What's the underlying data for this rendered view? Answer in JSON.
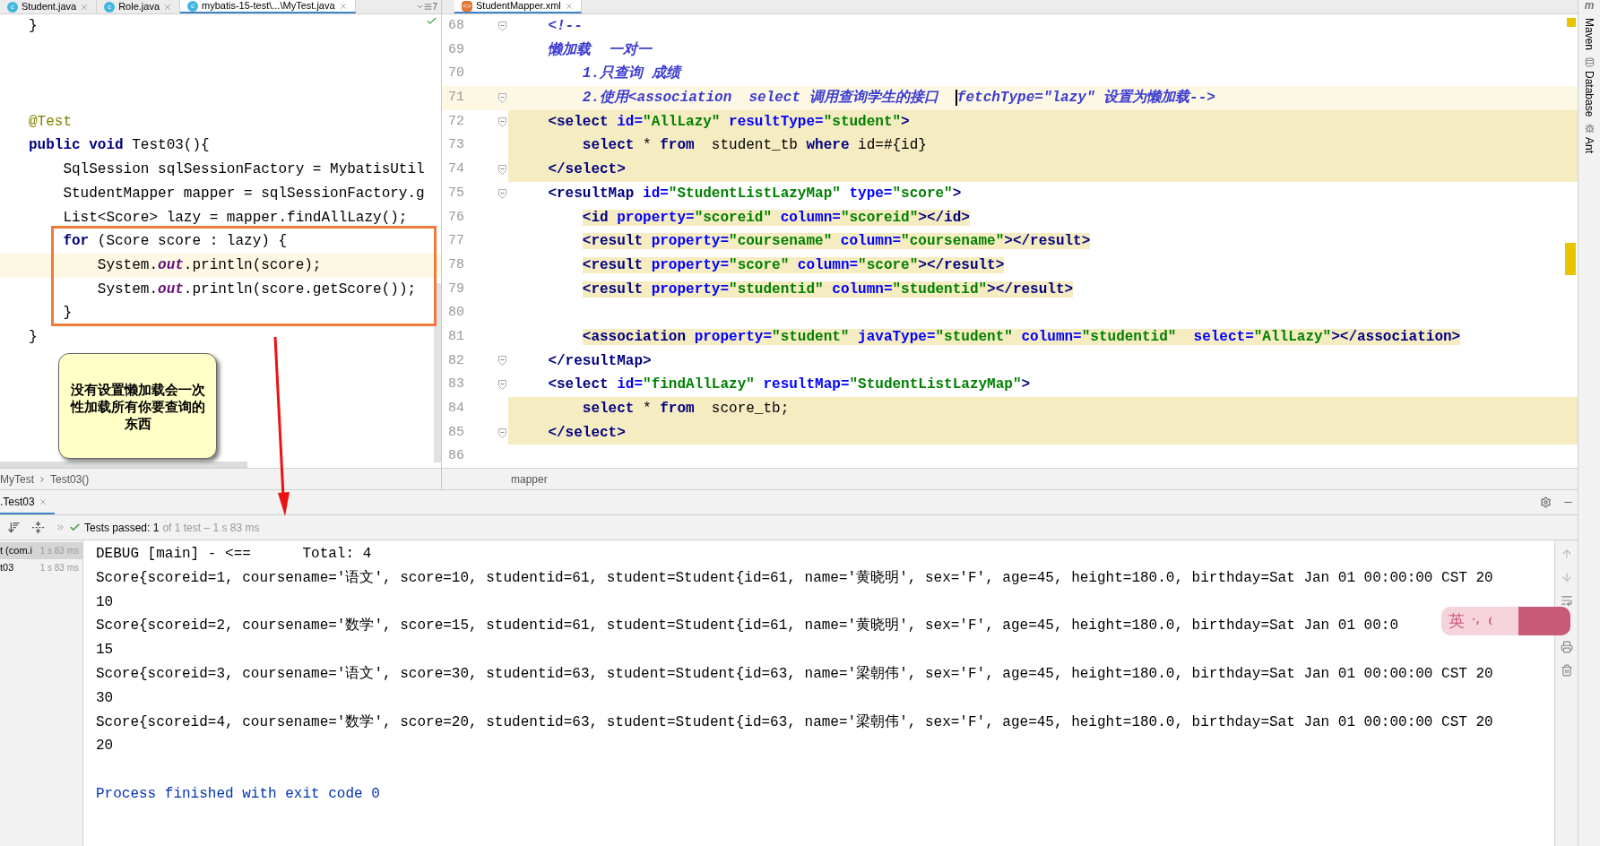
{
  "left_editor": {
    "tabs": [
      {
        "label": "Student.java",
        "badge": "c",
        "selected": false
      },
      {
        "label": "Role.java",
        "badge": "c",
        "selected": false
      },
      {
        "label": "mybatis-15-test\\...\\MyTest.java",
        "badge": "c",
        "selected": true
      }
    ],
    "overflow_count": "7",
    "lines": [
      {
        "highlighted": false,
        "segments": [
          {
            "kind": "plain",
            "text": "}"
          }
        ]
      },
      {
        "highlighted": false
      },
      {
        "highlighted": false
      },
      {
        "highlighted": false
      },
      {
        "highlighted": false,
        "segments": [
          {
            "kind": "ann",
            "text": "@Test"
          }
        ]
      },
      {
        "highlighted": false,
        "segments": [
          {
            "kind": "kw",
            "text": "public void"
          },
          {
            "kind": "plain",
            "text": " Test03(){"
          }
        ]
      },
      {
        "highlighted": false,
        "segments": [
          {
            "kind": "plain",
            "text": "    SqlSession sqlSessionFactory = MybatisUtil"
          }
        ]
      },
      {
        "highlighted": false,
        "segments": [
          {
            "kind": "plain",
            "text": "    StudentMapper mapper = sqlSessionFactory.g"
          }
        ]
      },
      {
        "highlighted": false,
        "segments": [
          {
            "kind": "plain",
            "text": "    List<Score> lazy = mapper.findAllLazy();"
          }
        ]
      },
      {
        "highlighted": false,
        "segments": [
          {
            "kind": "kw",
            "text": "    for"
          },
          {
            "kind": "plain",
            "text": " (Score score : lazy) {"
          }
        ]
      },
      {
        "highlighted": true,
        "segments": [
          {
            "kind": "plain",
            "text": "        System."
          },
          {
            "kind": "field",
            "text": "out"
          },
          {
            "kind": "plain",
            "text": ".println(score);"
          }
        ]
      },
      {
        "highlighted": false,
        "segments": [
          {
            "kind": "plain",
            "text": "        System."
          },
          {
            "kind": "field",
            "text": "out"
          },
          {
            "kind": "plain",
            "text": ".println(score.getScore());"
          }
        ]
      },
      {
        "highlighted": false,
        "segments": [
          {
            "kind": "plain",
            "text": "    }"
          }
        ]
      },
      {
        "highlighted": false,
        "segments": [
          {
            "kind": "plain",
            "text": "}"
          }
        ]
      }
    ],
    "note": "没有设置懒加载会一次性加载所有你要查询的东西"
  },
  "right_editor": {
    "tabs": [
      {
        "label": "StudentMapper.xml",
        "badge": "<>",
        "selected": true
      }
    ],
    "lines": [
      {
        "number": "68",
        "fold": true,
        "current_line": false,
        "shaded": false,
        "tag_shaded": false,
        "segments": [
          {
            "kind": "comment",
            "text": "    <!--"
          }
        ]
      },
      {
        "number": "69",
        "fold": false,
        "current_line": false,
        "shaded": false,
        "tag_shaded": false,
        "segments": [
          {
            "kind": "comment",
            "text": "    懒加载  一对一"
          }
        ]
      },
      {
        "number": "70",
        "fold": false,
        "current_line": false,
        "shaded": false,
        "tag_shaded": false,
        "segments": [
          {
            "kind": "comment",
            "text": "        1.只查询 成绩"
          }
        ]
      },
      {
        "number": "71",
        "fold": true,
        "current_line": true,
        "shaded": false,
        "tag_shaded": false,
        "segments": [
          {
            "kind": "comment",
            "text": "        2.使用<association  select 调用查询学生的接口  "
          },
          {
            "kind": "comment",
            "text": "fetchType=\"lazy\" 设置为懒加载-->",
            "cursor": true
          }
        ]
      },
      {
        "number": "72",
        "fold": true,
        "current_line": false,
        "shaded": true,
        "tag_shaded": false,
        "segments": [
          {
            "kind": "tag",
            "text": "    <select"
          },
          {
            "kind": "attr",
            "text": " id="
          },
          {
            "kind": "val",
            "text": "\"AllLazy\""
          },
          {
            "kind": "attr",
            "text": " resultType="
          },
          {
            "kind": "val",
            "text": "\"student\""
          },
          {
            "kind": "tag",
            "text": ">"
          }
        ]
      },
      {
        "number": "73",
        "fold": false,
        "current_line": false,
        "shaded": true,
        "tag_shaded": false,
        "segments": [
          {
            "kind": "sql",
            "text": "        select"
          },
          {
            "kind": "plain",
            "text": " * "
          },
          {
            "kind": "sql",
            "text": "from"
          },
          {
            "kind": "plain",
            "text": "  student_tb "
          },
          {
            "kind": "sql",
            "text": "where"
          },
          {
            "kind": "plain",
            "text": " id=#{id}"
          }
        ]
      },
      {
        "number": "74",
        "fold": true,
        "current_line": false,
        "shaded": true,
        "tag_shaded": false,
        "segments": [
          {
            "kind": "tag",
            "text": "    </select>"
          }
        ]
      },
      {
        "number": "75",
        "fold": true,
        "current_line": false,
        "shaded": false,
        "tag_shaded": false,
        "segments": [
          {
            "kind": "tag",
            "text": "    <resultMap"
          },
          {
            "kind": "attr",
            "text": " id="
          },
          {
            "kind": "val",
            "text": "\"StudentListLazyMap\""
          },
          {
            "kind": "attr",
            "text": " type="
          },
          {
            "kind": "val",
            "text": "\"score\""
          },
          {
            "kind": "tag",
            "text": ">"
          }
        ]
      },
      {
        "number": "76",
        "fold": false,
        "current_line": false,
        "shaded": false,
        "tag_shaded": true,
        "segments": [
          {
            "kind": "tag",
            "text": "        <id"
          },
          {
            "kind": "attr",
            "text": " property="
          },
          {
            "kind": "val",
            "text": "\"scoreid\""
          },
          {
            "kind": "attr",
            "text": " column="
          },
          {
            "kind": "val",
            "text": "\"scoreid\""
          },
          {
            "kind": "tag",
            "text": "></id>"
          }
        ]
      },
      {
        "number": "77",
        "fold": false,
        "current_line": false,
        "shaded": false,
        "tag_shaded": true,
        "segments": [
          {
            "kind": "tag",
            "text": "        <result"
          },
          {
            "kind": "attr",
            "text": " property="
          },
          {
            "kind": "val",
            "text": "\"coursename\""
          },
          {
            "kind": "attr",
            "text": " column="
          },
          {
            "kind": "val",
            "text": "\"coursename\""
          },
          {
            "kind": "tag",
            "text": "></result>"
          }
        ]
      },
      {
        "number": "78",
        "fold": false,
        "current_line": false,
        "shaded": false,
        "tag_shaded": true,
        "segments": [
          {
            "kind": "tag",
            "text": "        <result"
          },
          {
            "kind": "attr",
            "text": " property="
          },
          {
            "kind": "val",
            "text": "\"score\""
          },
          {
            "kind": "attr",
            "text": " column="
          },
          {
            "kind": "val",
            "text": "\"score\""
          },
          {
            "kind": "tag",
            "text": "></result>"
          }
        ]
      },
      {
        "number": "79",
        "fold": false,
        "current_line": false,
        "shaded": false,
        "tag_shaded": true,
        "segments": [
          {
            "kind": "tag",
            "text": "        <result"
          },
          {
            "kind": "attr",
            "text": " property="
          },
          {
            "kind": "val",
            "text": "\"studentid\""
          },
          {
            "kind": "attr",
            "text": " column="
          },
          {
            "kind": "val",
            "text": "\"studentid\""
          },
          {
            "kind": "tag",
            "text": "></result>"
          }
        ]
      },
      {
        "number": "80",
        "fold": false,
        "current_line": false,
        "shaded": false
      },
      {
        "number": "81",
        "fold": false,
        "current_line": false,
        "shaded": false,
        "tag_shaded": true,
        "segments": [
          {
            "kind": "tag",
            "text": "        <association"
          },
          {
            "kind": "attr",
            "text": " property="
          },
          {
            "kind": "val",
            "text": "\"student\""
          },
          {
            "kind": "attr",
            "text": " javaType="
          },
          {
            "kind": "val",
            "text": "\"student\""
          },
          {
            "kind": "attr",
            "text": " column="
          },
          {
            "kind": "val",
            "text": "\"studentid\""
          },
          {
            "kind": "attr",
            "text": "  select="
          },
          {
            "kind": "val",
            "text": "\"AllLazy\""
          },
          {
            "kind": "tag",
            "text": "></association>"
          }
        ]
      },
      {
        "number": "82",
        "fold": true,
        "current_line": false,
        "shaded": false,
        "tag_shaded": false,
        "segments": [
          {
            "kind": "tag",
            "text": "    </resultMap>"
          }
        ]
      },
      {
        "number": "83",
        "fold": true,
        "current_line": false,
        "shaded": false,
        "tag_shaded": false,
        "segments": [
          {
            "kind": "tag",
            "text": "    <select"
          },
          {
            "kind": "attr",
            "text": " id="
          },
          {
            "kind": "val",
            "text": "\"findAllLazy\""
          },
          {
            "kind": "attr",
            "text": " resultMap="
          },
          {
            "kind": "val",
            "text": "\"StudentListLazyMap\""
          },
          {
            "kind": "tag",
            "text": ">"
          }
        ]
      },
      {
        "number": "84",
        "fold": false,
        "current_line": false,
        "shaded": true,
        "tag_shaded": false,
        "segments": [
          {
            "kind": "sql",
            "text": "        select"
          },
          {
            "kind": "plain",
            "text": " * "
          },
          {
            "kind": "sql",
            "text": "from"
          },
          {
            "kind": "plain",
            "text": "  score_tb;"
          }
        ]
      },
      {
        "number": "85",
        "fold": true,
        "current_line": false,
        "shaded": true,
        "tag_shaded": false,
        "segments": [
          {
            "kind": "tag",
            "text": "    </select>"
          }
        ]
      },
      {
        "number": "86",
        "fold": false,
        "current_line": false,
        "shaded": false
      }
    ]
  },
  "breadcrumbs": {
    "left": [
      "MyTest",
      "Test03()"
    ],
    "right": [
      "mapper"
    ]
  },
  "run_panel": {
    "tab": ".Test03",
    "passed": "Tests passed: 1",
    "detail": "of 1 test – 1 s 83 ms",
    "tree": [
      {
        "label": "t (com.i",
        "time": "1 s 83 ms",
        "selected": true
      },
      {
        "label": "t03",
        "time": "1 s 83 ms",
        "selected": false
      }
    ],
    "console": [
      {
        "kind": "output",
        "text": "DEBUG [main] - <==      Total: 4"
      },
      {
        "kind": "output",
        "text": "Score{scoreid=1, coursename='语文', score=10, studentid=61, student=Student{id=61, name='黄晓明', sex='F', age=45, height=180.0, birthday=Sat Jan 01 00:00:00 CST 20"
      },
      {
        "kind": "output",
        "text": "10"
      },
      {
        "kind": "output",
        "text": "Score{scoreid=2, coursename='数学', score=15, studentid=61, student=Student{id=61, name='黄晓明', sex='F', age=45, height=180.0, birthday=Sat Jan 01 00:0"
      },
      {
        "kind": "output",
        "text": "15"
      },
      {
        "kind": "output",
        "text": "Score{scoreid=3, coursename='语文', score=30, studentid=63, student=Student{id=63, name='梁朝伟', sex='F', age=45, height=180.0, birthday=Sat Jan 01 00:00:00 CST 20"
      },
      {
        "kind": "output",
        "text": "30"
      },
      {
        "kind": "output",
        "text": "Score{scoreid=4, coursename='数学', score=20, studentid=63, student=Student{id=63, name='梁朝伟', sex='F', age=45, height=180.0, birthday=Sat Jan 01 00:00:00 CST 20"
      },
      {
        "kind": "output",
        "text": "20"
      },
      {
        "kind": "exit",
        "text": "Process finished with exit code 0"
      }
    ]
  },
  "ime": {
    "label": "英"
  },
  "tool_windows": {
    "logo": "m",
    "items": [
      {
        "label": "Maven",
        "kind": "maven"
      },
      {
        "label": "Database",
        "kind": "database"
      },
      {
        "label": "Ant",
        "kind": "ant"
      }
    ]
  }
}
